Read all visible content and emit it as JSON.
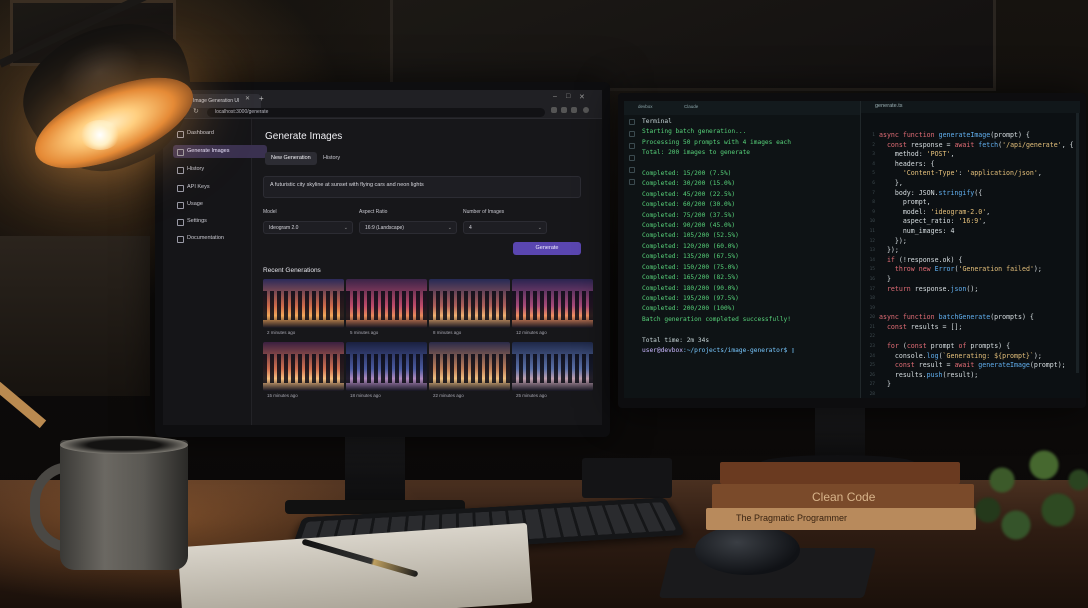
{
  "browser": {
    "tab_title": "Image Generation UI",
    "url": "localhost:3000/generate"
  },
  "sidebar": {
    "items": [
      {
        "label": "Dashboard"
      },
      {
        "label": "Generate Images"
      },
      {
        "label": "History"
      },
      {
        "label": "API Keys"
      },
      {
        "label": "Usage"
      },
      {
        "label": "Settings"
      },
      {
        "label": "Documentation"
      }
    ],
    "active_index": 1
  },
  "main": {
    "title": "Generate Images",
    "tabs": [
      {
        "label": "New Generation"
      },
      {
        "label": "History"
      }
    ],
    "prompt_value": "A futuristic city skyline at sunset with flying cars and neon lights",
    "model": {
      "label": "Model",
      "value": "Ideogram 2.0"
    },
    "aspect_ratio": {
      "label": "Aspect Ratio",
      "value": "16:9 (Landscape)"
    },
    "num_images": {
      "label": "Number of Images",
      "value": "4"
    },
    "generate_label": "Generate",
    "recent_title": "Recent Generations",
    "thumbnails": [
      {
        "caption": "2 minutes ago"
      },
      {
        "caption": "5 minutes ago"
      },
      {
        "caption": "8 minutes ago"
      },
      {
        "caption": "12 minutes ago"
      },
      {
        "caption": "15 minutes ago"
      },
      {
        "caption": "18 minutes ago"
      },
      {
        "caption": "22 minutes ago"
      },
      {
        "caption": "25 minutes ago"
      }
    ]
  },
  "terminal": {
    "tab_label": "devbox",
    "tab2_label": "Claude",
    "lines": [
      "Terminal",
      "Starting batch generation...",
      "Processing 50 prompts with 4 images each",
      "Total: 200 images to generate",
      "",
      "Completed: 15/200 (7.5%)",
      "Completed: 30/200 (15.0%)",
      "Completed: 45/200 (22.5%)",
      "Completed: 60/200 (30.0%)",
      "Completed: 75/200 (37.5%)",
      "Completed: 90/200 (45.0%)",
      "Completed: 105/200 (52.5%)",
      "Completed: 120/200 (60.0%)",
      "Completed: 135/200 (67.5%)",
      "Completed: 150/200 (75.0%)",
      "Completed: 165/200 (82.5%)",
      "Completed: 180/200 (90.0%)",
      "Completed: 195/200 (97.5%)",
      "Completed: 200/200 (100%)",
      "Batch generation completed successfully!",
      "",
      "Total time: 2m 34s"
    ],
    "prompt_user": "user@devbox",
    "prompt_path": ":~/projects/image-generator$"
  },
  "editor": {
    "file_label": "generate.ts",
    "code": [
      "async function generateImage(prompt) {",
      "  const response = await fetch('/api/generate', {",
      "    method: 'POST',",
      "    headers: {",
      "      'Content-Type': 'application/json',",
      "    },",
      "    body: JSON.stringify({",
      "      prompt,",
      "      model: 'ideogram-2.0',",
      "      aspect_ratio: '16:9',",
      "      num_images: 4",
      "    });",
      "  });",
      "  if (!response.ok) {",
      "    throw new Error('Generation failed');",
      "  }",
      "  return response.json();",
      "",
      "",
      "async function batchGenerate(prompts) {",
      "  const results = [];",
      "",
      "  for (const prompt of prompts) {",
      "    console.log(`Generating: ${prompt}`);",
      "    const result = await generateImage(prompt);",
      "    results.push(result);",
      "  }",
      "",
      "  return results;"
    ]
  },
  "books": [
    {
      "title": "Clean Code"
    },
    {
      "title": "The Pragmatic Programmer"
    }
  ],
  "colors": {
    "accent": "#5a46b0",
    "terminal_green": "#57d27a",
    "lamp_glow": "#ffcf80"
  }
}
